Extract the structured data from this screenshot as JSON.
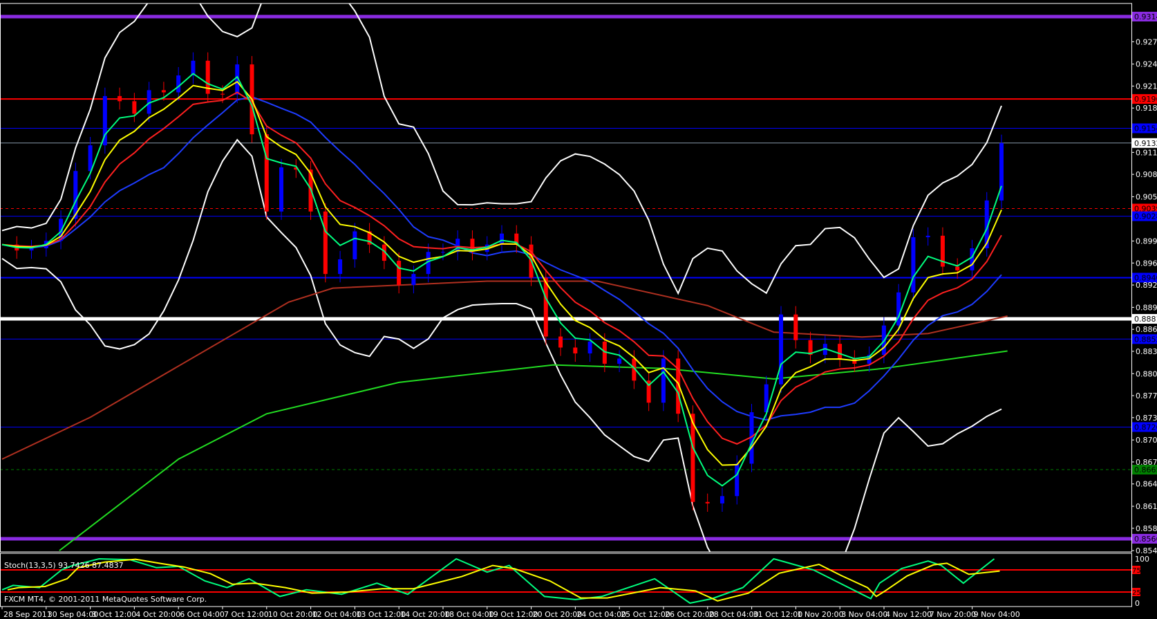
{
  "chart_data": {
    "type": "line",
    "title": "EUR/CHF style candlestick chart, FXCM MT4",
    "copyright": "FXCM MT4, © 2001-2011 MetaQuotes Software Corp.",
    "price_range": [
      0.8549,
      0.9314
    ],
    "price_ticks": [
      "0.92780",
      "0.92460",
      "0.92145",
      "0.91830",
      "0.91195",
      "0.90880",
      "0.90560",
      "0.89925",
      "0.89610",
      "0.89295",
      "0.88975",
      "0.88660",
      "0.88345",
      "0.88025",
      "0.87710",
      "0.87395",
      "0.87075",
      "0.86760",
      "0.86445",
      "0.86125",
      "0.85810",
      "0.85490"
    ],
    "time_labels": [
      "28 Sep 2011",
      "30 Sep 04:00",
      "3 Oct 12:00",
      "4 Oct 20:00",
      "6 Oct 04:00",
      "7 Oct 12:00",
      "10 Oct 20:00",
      "12 Oct 04:00",
      "13 Oct 12:00",
      "14 Oct 20:00",
      "18 Oct 04:00",
      "19 Oct 12:00",
      "20 Oct 20:00",
      "24 Oct 04:00",
      "25 Oct 12:00",
      "26 Oct 20:00",
      "28 Oct 04:00",
      "31 Oct 12:00",
      "1 Nov 20:00",
      "3 Nov 04:00",
      "4 Nov 12:00",
      "7 Nov 20:00",
      "9 Nov 04:00"
    ],
    "close_step_labels": 0.3333,
    "closes": [
      0.89874,
      0.8979,
      0.89821,
      0.89927,
      0.90243,
      0.90928,
      0.91296,
      0.92002,
      0.91928,
      0.91749,
      0.92086,
      0.92055,
      0.92297,
      0.92508,
      0.92034,
      0.92023,
      0.92455,
      0.91454,
      0.90348,
      0.9098,
      0.90949,
      0.90348,
      0.89453,
      0.89663,
      0.90064,
      0.89874,
      0.89642,
      0.89295,
      0.89453,
      0.89769,
      0.89769,
      0.89958,
      0.89769,
      0.89874,
      0.90032,
      0.89874,
      0.894,
      0.88557,
      0.88399,
      0.88315,
      0.88484,
      0.88167,
      0.88241,
      0.87925,
      0.87609,
      0.88241,
      0.87451,
      0.86187,
      0.86166,
      0.86271,
      0.86735,
      0.87472,
      0.87872,
      0.88873,
      0.88505,
      0.88294,
      0.88452,
      0.88241,
      0.88167,
      0.88294,
      0.88715,
      0.89189,
      0.89979,
      0.90001,
      0.89558,
      0.89505,
      0.89821,
      0.90506,
      0.91329
    ],
    "slow_ma_green": [
      [
        1.3,
        0.8549
      ],
      [
        4,
        0.868
      ],
      [
        6,
        0.8745
      ],
      [
        9,
        0.879
      ],
      [
        12.5,
        0.8815
      ],
      [
        15,
        0.881
      ],
      [
        17.5,
        0.8795
      ],
      [
        20,
        0.881
      ],
      [
        22.8,
        0.8835
      ]
    ],
    "slow_ma_brown": [
      [
        0,
        0.868
      ],
      [
        2,
        0.874
      ],
      [
        5,
        0.885
      ],
      [
        6.5,
        0.8905
      ],
      [
        7.5,
        0.8925
      ],
      [
        11,
        0.8935
      ],
      [
        13.5,
        0.8935
      ],
      [
        16,
        0.89
      ],
      [
        17.5,
        0.8862
      ],
      [
        19.5,
        0.8855
      ],
      [
        21,
        0.886
      ],
      [
        22.8,
        0.8885
      ]
    ],
    "horizontal_levels": [
      {
        "price": "0.93140",
        "color": "#8a2be2",
        "style": "thick"
      },
      {
        "price": "0.91960",
        "color": "#ff0000",
        "style": "solid"
      },
      {
        "price": "0.91540",
        "color": "#0000ff",
        "style": "thin"
      },
      {
        "price": "0.91329",
        "color": "#ffffff",
        "style": "current"
      },
      {
        "price": "0.90390",
        "color": "#ff0000",
        "style": "dashed"
      },
      {
        "price": "0.90280",
        "color": "#0000ff",
        "style": "thin"
      },
      {
        "price": "0.89400",
        "color": "#0000ff",
        "style": "solid"
      },
      {
        "price": "0.88810",
        "color": "#ffffff",
        "style": "thick"
      },
      {
        "price": "0.88520",
        "color": "#0000ff",
        "style": "thin"
      },
      {
        "price": "0.87260",
        "color": "#0000ff",
        "style": "thin"
      },
      {
        "price": "0.86650",
        "color": "#008000",
        "style": "dashed"
      },
      {
        "price": "0.85660",
        "color": "#8a2be2",
        "style": "thick"
      }
    ],
    "stochastic": {
      "label": "Stoch(13,3,5) 93.7426 87.4837",
      "levels": [
        "75",
        "25"
      ],
      "axis": [
        "100",
        "0"
      ],
      "k": [
        [
          0,
          30
        ],
        [
          0.25,
          40
        ],
        [
          0.85,
          35
        ],
        [
          1.35,
          75
        ],
        [
          1.6,
          85
        ],
        [
          2.2,
          100
        ],
        [
          2.9,
          98
        ],
        [
          3.5,
          80
        ],
        [
          4,
          83
        ],
        [
          4.6,
          50
        ],
        [
          5.1,
          35
        ],
        [
          5.6,
          55
        ],
        [
          6.3,
          15
        ],
        [
          6.9,
          30
        ],
        [
          7.7,
          20
        ],
        [
          8.5,
          45
        ],
        [
          9.2,
          20
        ],
        [
          10.3,
          100
        ],
        [
          11,
          70
        ],
        [
          11.5,
          85
        ],
        [
          12.3,
          15
        ],
        [
          13,
          8
        ],
        [
          13.6,
          15
        ],
        [
          14.8,
          55
        ],
        [
          15.6,
          0
        ],
        [
          16.1,
          10
        ],
        [
          16.8,
          35
        ],
        [
          17.5,
          100
        ],
        [
          18.4,
          75
        ],
        [
          18.9,
          50
        ],
        [
          19.5,
          20
        ],
        [
          19.7,
          10
        ],
        [
          19.9,
          45
        ],
        [
          20.4,
          78
        ],
        [
          21,
          95
        ],
        [
          21.3,
          85
        ],
        [
          21.8,
          45
        ],
        [
          22.5,
          100
        ]
      ]
    },
    "colors": {
      "bull": "#0000ff",
      "bear": "#ff0000",
      "ema_fast": "#00ff7f",
      "ema_mid": "#ffff00",
      "ema_slow": "#ff2020",
      "ma_blue": "#1e3cff",
      "bands": "#ffffff"
    }
  }
}
